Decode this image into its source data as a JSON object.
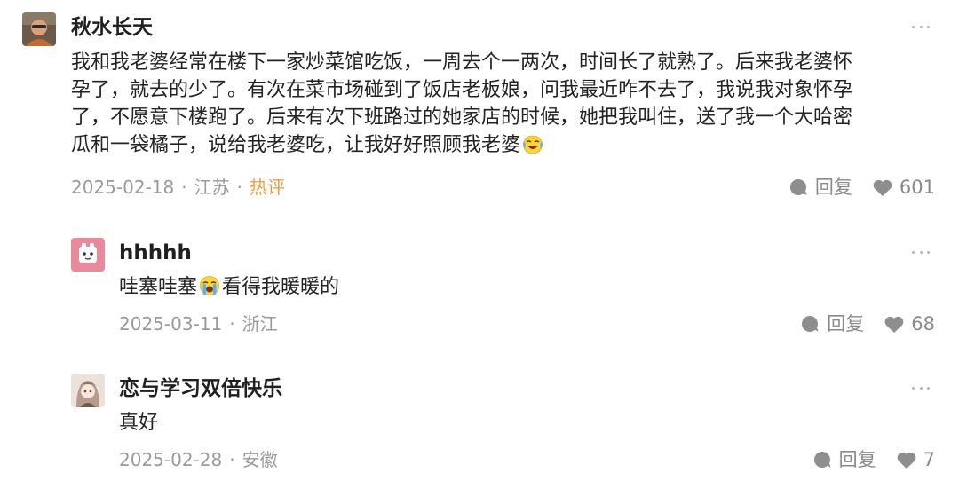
{
  "colors": {
    "text_primary": "#222222",
    "text_secondary": "#9a9a9a",
    "hot_tag": "#f29c38",
    "icon_gray": "#9a9a9a"
  },
  "comments": [
    {
      "username": "秋水长天",
      "avatar_icon": "avatar-photo-icon",
      "text_lines": [
        "我和我老婆经常在楼下一家炒菜馆吃饭，一周去个一两次，时间长了就熟了。后来我老婆怀",
        "孕了，就去的少了。有次在菜市场碰到了饭店老板娘，问我最近咋不去了，我说我对象怀孕",
        "了，不愿意下楼跑了。后来有次下班路过的她家店的时候，她把我叫住，送了我一个大哈密",
        "瓜和一袋橘子，说给我老婆吃，让我好好照顾我老婆"
      ],
      "emoji_icon": "laughing-tears-emoji-icon",
      "date": "2025-02-18",
      "location": "江苏",
      "tag": "热评",
      "reply_label": "回复",
      "likes": "601"
    },
    {
      "username": "hhhhh",
      "avatar_icon": "avatar-pink-cartoon-icon",
      "text_before": "哇塞哇塞",
      "emoji_icon": "crying-emoji-icon",
      "text_after": "看得我暖暖的",
      "date": "2025-03-11",
      "location": "浙江",
      "reply_label": "回复",
      "likes": "68"
    },
    {
      "username": "恋与学习双倍快乐",
      "avatar_icon": "avatar-anime-girl-icon",
      "text": "真好",
      "date": "2025-02-28",
      "location": "安徽",
      "reply_label": "回复",
      "likes": "7"
    }
  ]
}
